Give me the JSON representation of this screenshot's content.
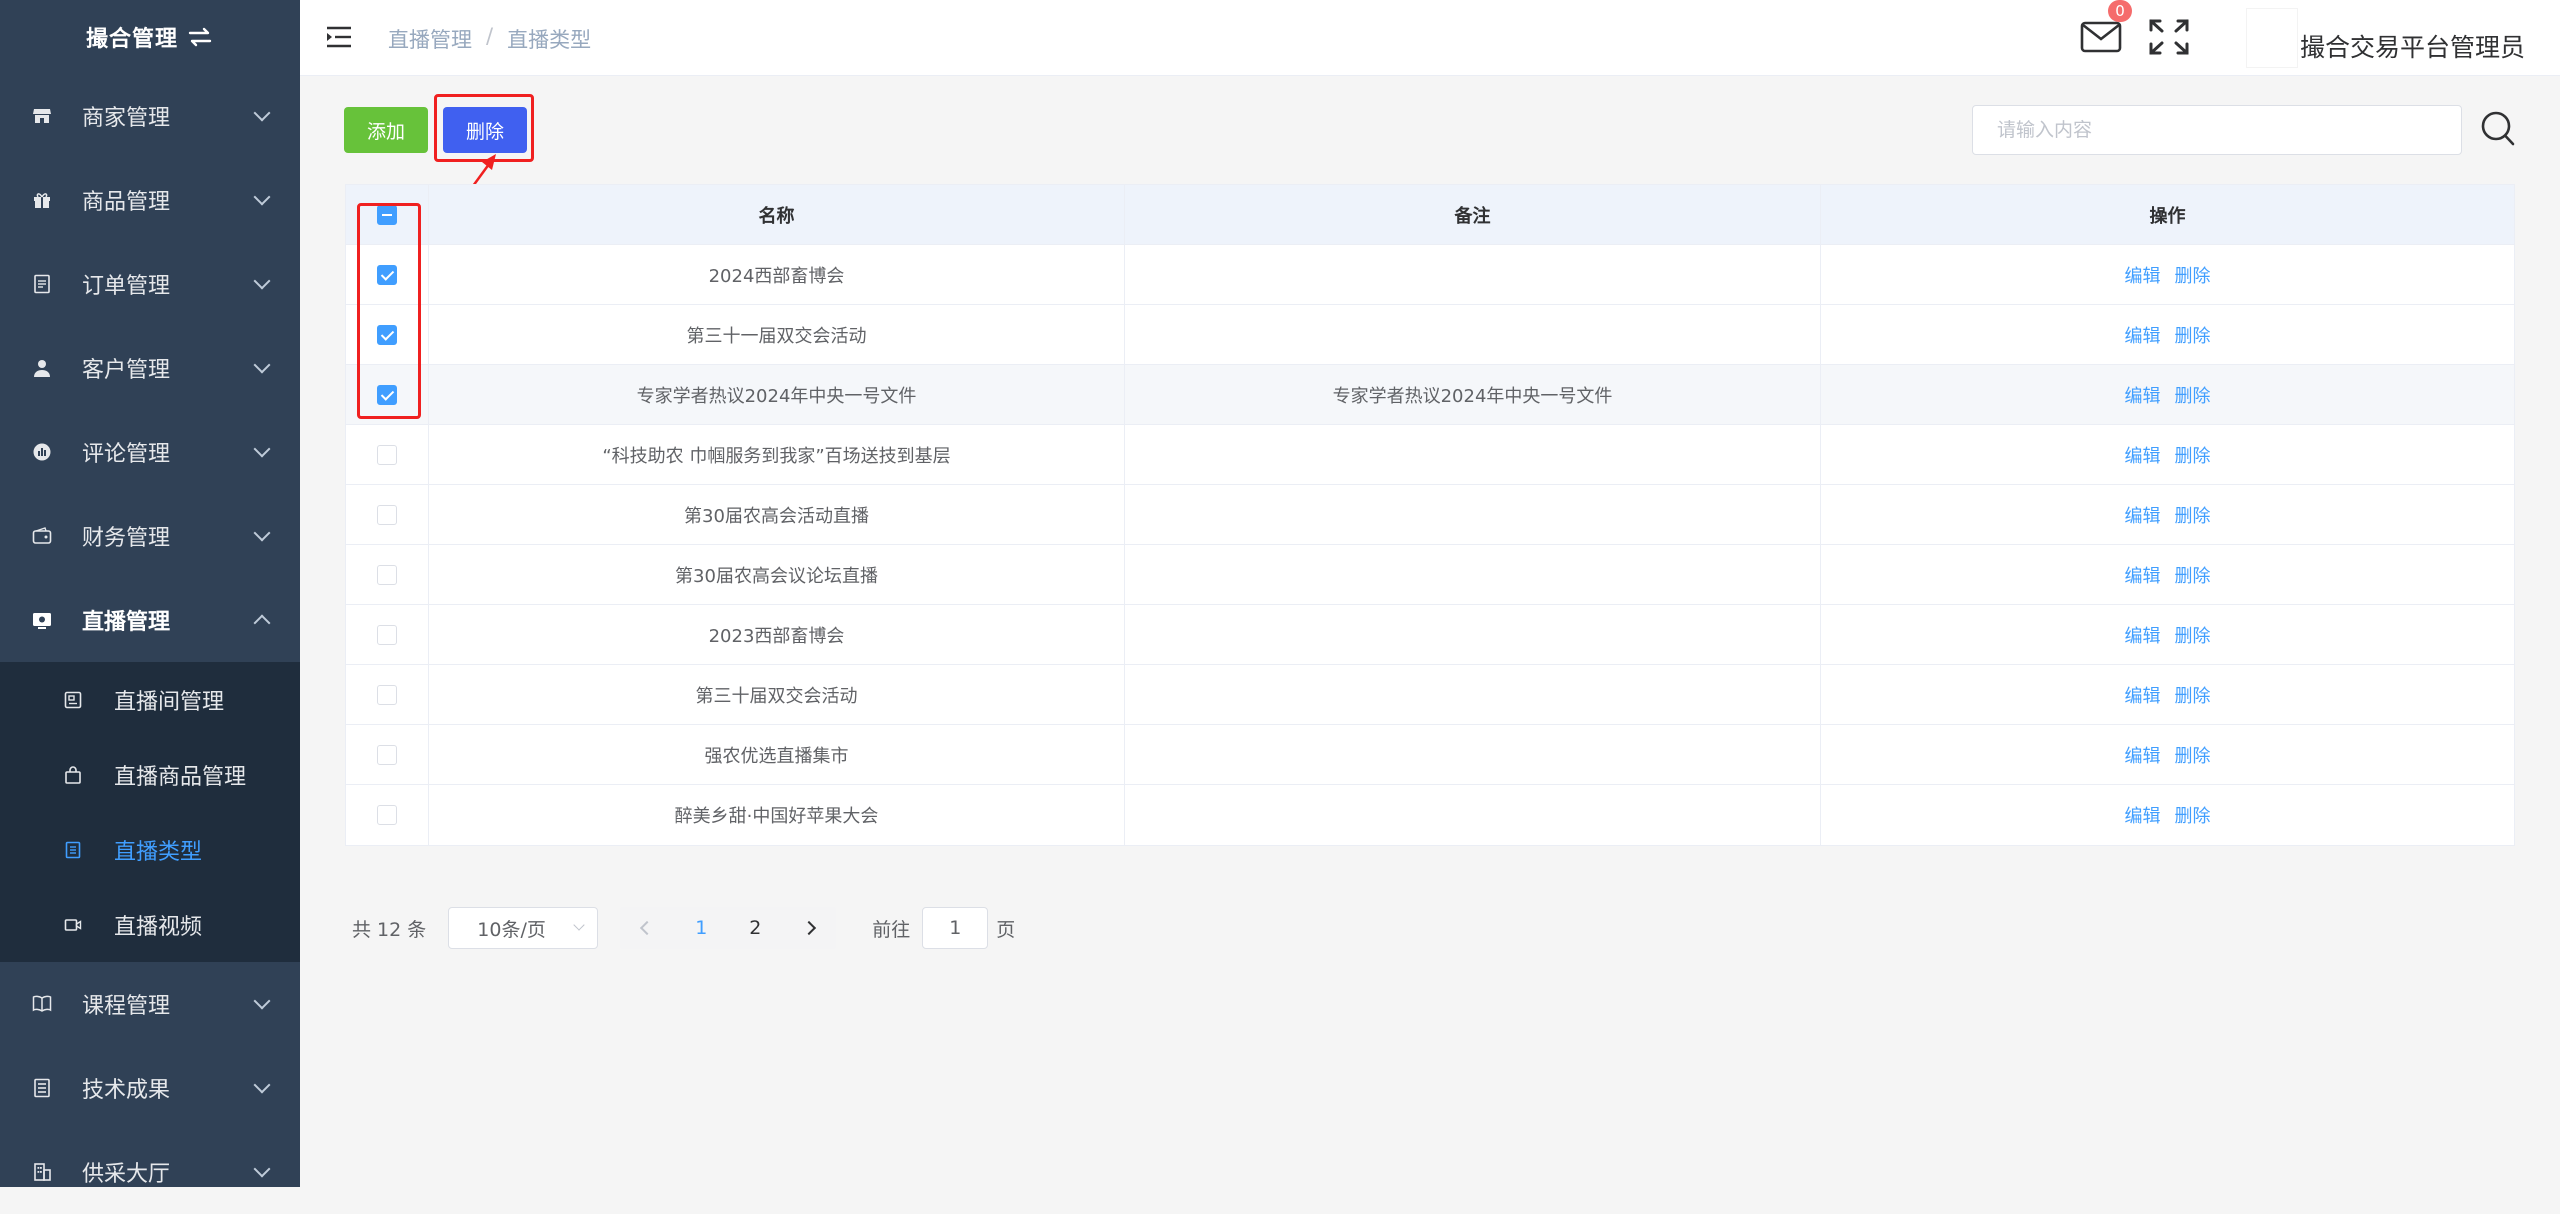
{
  "sidebar": {
    "brand": "撮合管理",
    "menu_top": [
      {
        "label": "商家管理",
        "icon": "store-icon"
      },
      {
        "label": "商品管理",
        "icon": "gift-icon"
      },
      {
        "label": "订单管理",
        "icon": "document-icon"
      },
      {
        "label": "客户管理",
        "icon": "user-icon"
      },
      {
        "label": "评论管理",
        "icon": "comment-icon"
      },
      {
        "label": "财务管理",
        "icon": "wallet-icon"
      }
    ],
    "open_menu": {
      "label": "直播管理",
      "icon": "live-icon"
    },
    "submenu": [
      {
        "label": "直播间管理",
        "icon": "room-icon"
      },
      {
        "label": "直播商品管理",
        "icon": "bag-icon"
      },
      {
        "label": "直播类型",
        "icon": "list-icon",
        "active": true
      },
      {
        "label": "直播视频",
        "icon": "video-icon"
      }
    ],
    "menu_bottom": [
      {
        "label": "课程管理",
        "icon": "book-icon"
      },
      {
        "label": "技术成果",
        "icon": "report-icon"
      },
      {
        "label": "供采大厅",
        "icon": "building-icon"
      }
    ]
  },
  "header": {
    "breadcrumb": [
      "直播管理",
      "直播类型"
    ],
    "breadcrumb_sep": "/",
    "mail_badge": "0",
    "username": "撮合交易平台管理员"
  },
  "toolbar": {
    "add_label": "添加",
    "delete_label": "删除",
    "search_placeholder": "请输入内容"
  },
  "table": {
    "headers": [
      "名称",
      "备注",
      "操作"
    ],
    "edit_label": "编辑",
    "delete_label": "删除",
    "rows": [
      {
        "name": "2024西部畜博会",
        "note": "",
        "checked": true
      },
      {
        "name": "第三十一届双交会活动",
        "note": "",
        "checked": true
      },
      {
        "name": "专家学者热议2024年中央一号文件",
        "note": "专家学者热议2024年中央一号文件",
        "checked": true
      },
      {
        "name": "“科技助农 巾帼服务到我家”百场送技到基层",
        "note": "",
        "checked": false
      },
      {
        "name": "第30届农高会活动直播",
        "note": "",
        "checked": false
      },
      {
        "name": "第30届农高会议论坛直播",
        "note": "",
        "checked": false
      },
      {
        "name": "2023西部畜博会",
        "note": "",
        "checked": false
      },
      {
        "name": "第三十届双交会活动",
        "note": "",
        "checked": false
      },
      {
        "name": "强农优选直播集市",
        "note": "",
        "checked": false
      },
      {
        "name": "醉美乡甜·中国好苹果大会",
        "note": "",
        "checked": false
      }
    ]
  },
  "pagination": {
    "total": "共 12 条",
    "page_size": "10条/页",
    "pages": [
      "1",
      "2"
    ],
    "current": "1",
    "goto_label": "前往",
    "goto_value": "1",
    "page_suffix": "页"
  },
  "colors": {
    "sidebar_bg": "#304156",
    "submenu_bg": "#1f2d3d",
    "accent": "#409eff",
    "add_button": "#67c23a",
    "delete_button": "#4060f0",
    "highlight": "#f02020"
  }
}
